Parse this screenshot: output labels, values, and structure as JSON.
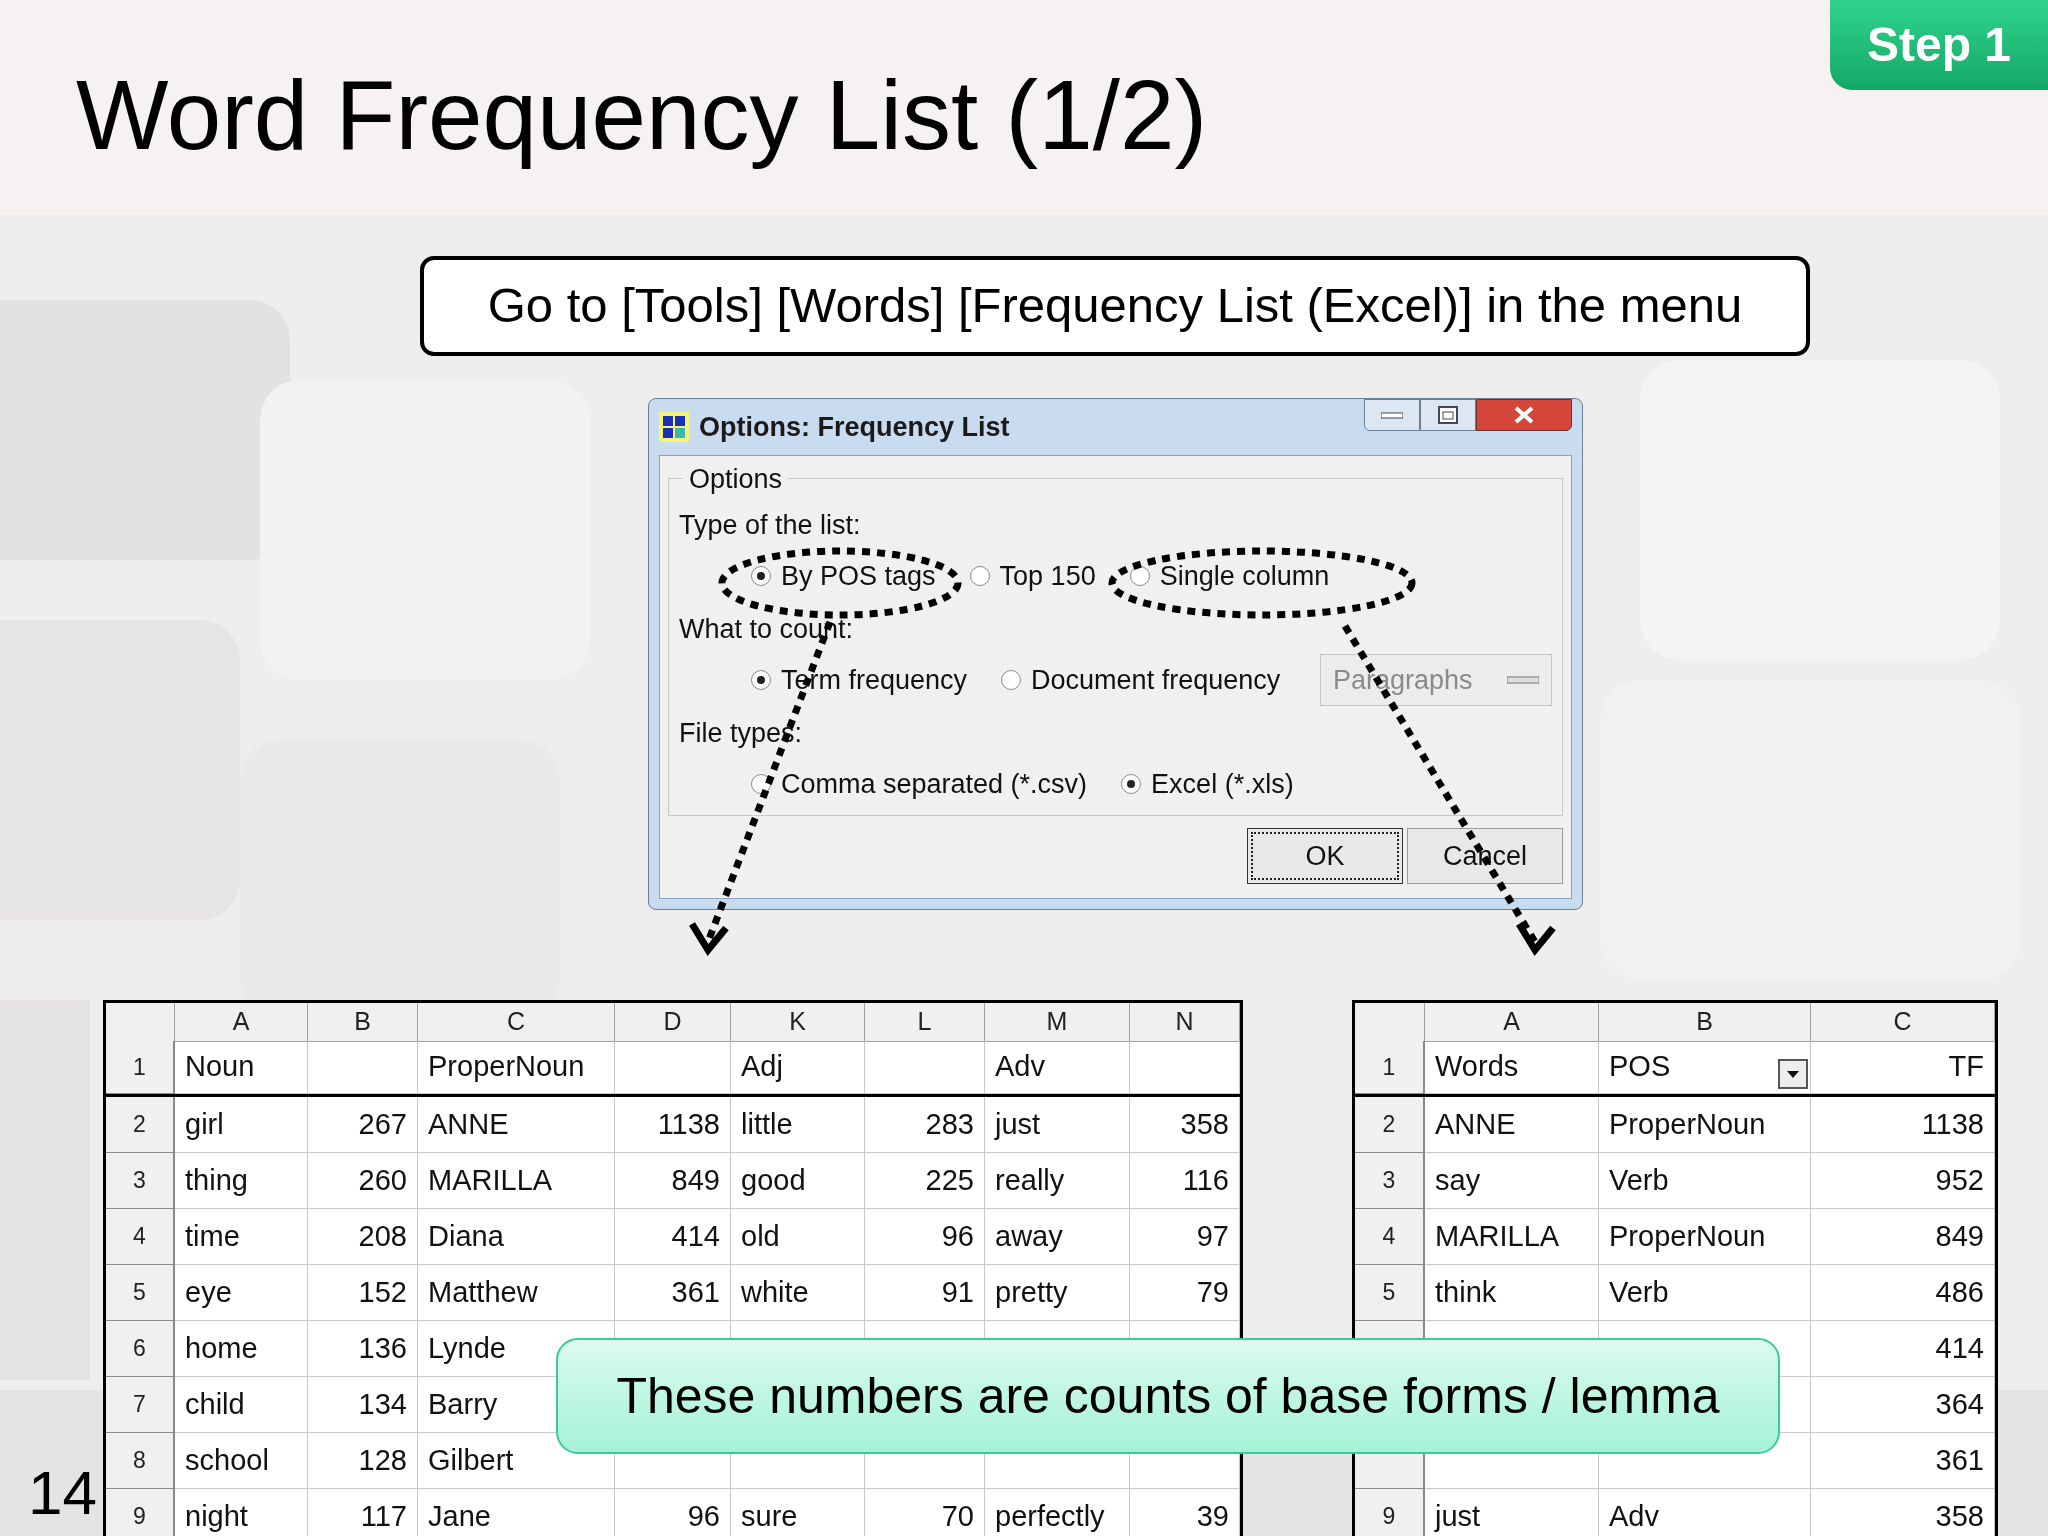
{
  "slide": {
    "title": "Word Frequency List (1/2)",
    "step_badge": "Step 1",
    "number": "14"
  },
  "instruction": "Go to [Tools] [Words] [Frequency List (Excel)] in the menu",
  "dialog": {
    "title": "Options: Frequency List",
    "group": "Options",
    "sections": [
      {
        "label": "Type of the list:",
        "options": [
          {
            "label": "By POS tags",
            "selected": true,
            "highlighted": true
          },
          {
            "label": "Top 150",
            "selected": false,
            "highlighted": false
          },
          {
            "label": "Single column",
            "selected": false,
            "highlighted": true
          }
        ]
      },
      {
        "label": "What to count:",
        "options": [
          {
            "label": "Term frequency",
            "selected": true
          },
          {
            "label": "Document frequency",
            "selected": false
          }
        ],
        "dropdown": {
          "value": "Paragraphs",
          "disabled": true
        }
      },
      {
        "label": "File types:",
        "options": [
          {
            "label": "Comma separated (*.csv)",
            "selected": false
          },
          {
            "label": "Excel (*.xls)",
            "selected": true
          }
        ]
      }
    ],
    "buttons": [
      {
        "label": "OK",
        "focused": true
      },
      {
        "label": "Cancel",
        "focused": false
      }
    ]
  },
  "left_table": {
    "columns": [
      {
        "label": "A",
        "kind": "text"
      },
      {
        "label": "B",
        "kind": "number"
      },
      {
        "label": "C",
        "kind": "text"
      },
      {
        "label": "D",
        "kind": "number"
      },
      {
        "label": "K",
        "kind": "text"
      },
      {
        "label": "L",
        "kind": "number"
      },
      {
        "label": "M",
        "kind": "text"
      },
      {
        "label": "N",
        "kind": "number"
      }
    ],
    "rows": [
      {
        "number": "1",
        "cells": [
          "Noun",
          null,
          "ProperNoun",
          null,
          "Adj",
          null,
          "Adv",
          null
        ]
      },
      {
        "number": "2",
        "cells": [
          "girl",
          "267",
          "ANNE",
          "1138",
          "little",
          "283",
          "just",
          "358"
        ]
      },
      {
        "number": "3",
        "cells": [
          "thing",
          "260",
          "MARILLA",
          "849",
          "good",
          "225",
          "really",
          "116"
        ]
      },
      {
        "number": "4",
        "cells": [
          "time",
          "208",
          "Diana",
          "414",
          "old",
          "96",
          "away",
          "97"
        ]
      },
      {
        "number": "5",
        "cells": [
          "eye",
          "152",
          "Matthew",
          "361",
          "white",
          "91",
          "pretty",
          "79"
        ]
      },
      {
        "number": "6",
        "cells": [
          "home",
          "136",
          "Lynde",
          null,
          null,
          null,
          null,
          null
        ]
      },
      {
        "number": "7",
        "cells": [
          "child",
          "134",
          "Barry",
          null,
          null,
          null,
          null,
          null
        ]
      },
      {
        "number": "8",
        "cells": [
          "school",
          "128",
          "Gilbert",
          null,
          null,
          null,
          null,
          null
        ]
      },
      {
        "number": "9",
        "cells": [
          "night",
          "117",
          "Jane",
          "96",
          "sure",
          "70",
          "perfectly",
          "39"
        ]
      }
    ]
  },
  "right_table": {
    "autofilter": true,
    "columns": [
      {
        "label": "A",
        "kind": "text"
      },
      {
        "label": "B",
        "kind": "text"
      },
      {
        "label": "C",
        "kind": "number"
      }
    ],
    "rows": [
      {
        "number": "1",
        "cells": [
          "Words",
          "POS",
          "TF"
        ]
      },
      {
        "number": "2",
        "cells": [
          "ANNE",
          "ProperNoun",
          "1138"
        ]
      },
      {
        "number": "3",
        "cells": [
          "say",
          "Verb",
          "952"
        ]
      },
      {
        "number": "4",
        "cells": [
          "MARILLA",
          "ProperNoun",
          "849"
        ]
      },
      {
        "number": "5",
        "cells": [
          "think",
          "Verb",
          "486"
        ]
      },
      {
        "number": null,
        "cells": [
          null,
          null,
          "414"
        ]
      },
      {
        "number": null,
        "cells": [
          null,
          null,
          "364"
        ]
      },
      {
        "number": null,
        "cells": [
          null,
          null,
          "361"
        ]
      },
      {
        "number": "9",
        "cells": [
          "just",
          "Adv",
          "358"
        ]
      }
    ]
  },
  "callout": "These numbers are counts of base forms / lemma"
}
